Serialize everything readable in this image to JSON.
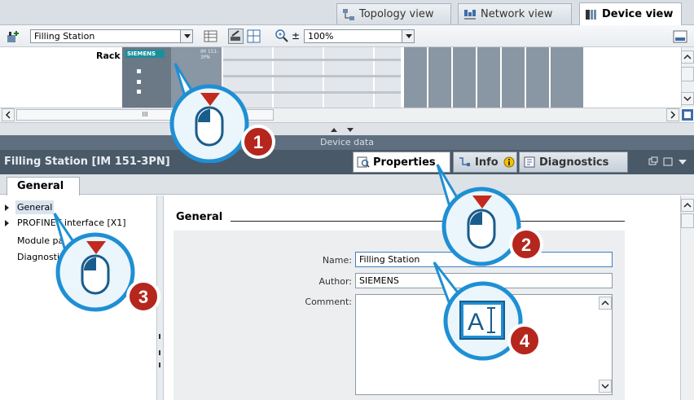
{
  "view_tabs": {
    "topology": "Topology view",
    "network": "Network view",
    "device": "Device view"
  },
  "toolbar": {
    "device_select": "Filling Station",
    "zoom_value": "100%"
  },
  "rack": {
    "label": "Rack",
    "brand": "SIEMENS",
    "module_text": "IM 151-3PN"
  },
  "hscroll_thumb": "III",
  "device_data_label": "Device data",
  "inspector": {
    "title": "Filling Station [IM 151-3PN]",
    "tabs": {
      "properties": "Properties",
      "info": "Info",
      "diagnostics": "Diagnostics"
    },
    "general_tab": "General"
  },
  "nav": {
    "items": [
      "General",
      "PROFINET interface [X1]",
      "Module parameters",
      "Diagnostics"
    ]
  },
  "form": {
    "section_title": "General",
    "name_label": "Name:",
    "name_value": "Filling Station",
    "author_label": "Author:",
    "author_value": "SIEMENS",
    "comment_label": "Comment:"
  },
  "callouts": [
    "1",
    "2",
    "3",
    "4"
  ],
  "icons": [
    "topology-icon",
    "network-icon",
    "device-icon",
    "properties-icon",
    "info-icon",
    "diagnostics-icon",
    "mouse-icon",
    "text-cursor-icon"
  ],
  "colors": {
    "callout_badge": "#b5261d",
    "callout_ring": "#1f8fd4",
    "inspector_header": "#4a5967"
  }
}
